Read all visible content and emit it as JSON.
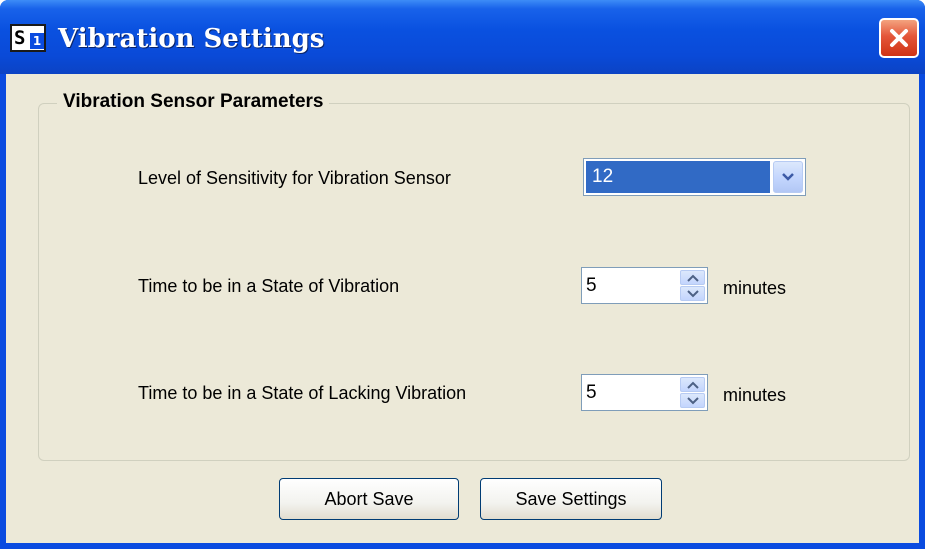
{
  "window": {
    "title": "Vibration Settings",
    "icon": "s1-app-icon",
    "icon_letter": "S",
    "icon_number": "1",
    "close_icon": "close-icon"
  },
  "group": {
    "title": "Vibration Sensor Parameters"
  },
  "fields": {
    "sensitivity": {
      "label": "Level of Sensitivity for Vibration Sensor",
      "value": "12",
      "control": "dropdown"
    },
    "vibration_time": {
      "label": "Time to be in a State of Vibration",
      "value": "5",
      "unit": "minutes",
      "control": "spinner"
    },
    "lacking_vibration_time": {
      "label": "Time to be in a State of Lacking Vibration",
      "value": "5",
      "unit": "minutes",
      "control": "spinner"
    }
  },
  "buttons": {
    "abort_label": "Abort Save",
    "save_label": "Save Settings"
  },
  "colors": {
    "titlebar": "#0a4be0",
    "close": "#e4563a",
    "dialog_bg": "#ece9d8",
    "selection": "#316ac5"
  }
}
